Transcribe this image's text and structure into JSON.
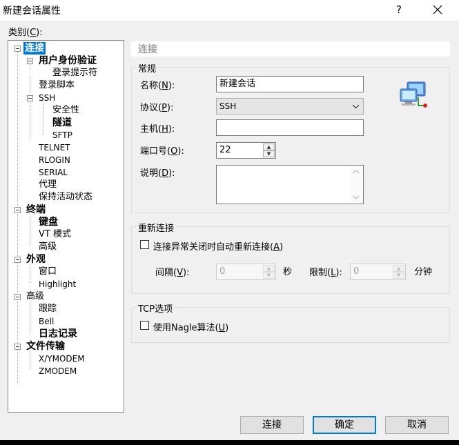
{
  "window": {
    "title": "新建会话属性",
    "help": "?",
    "close": "✕"
  },
  "category": {
    "label": "类别(",
    "label_key": "C",
    "label_end": "):"
  },
  "tree": {
    "n_connect": "连接",
    "n_user_auth": "用户身份验证",
    "n_login_prompt": "登录提示符",
    "n_login_script": "登录脚本",
    "n_ssh": "SSH",
    "n_security": "安全性",
    "n_tunnel": "隧道",
    "n_sftp": "SFTP",
    "n_telnet": "TELNET",
    "n_rlogin": "RLOGIN",
    "n_serial": "SERIAL",
    "n_proxy": "代理",
    "n_keepalive": "保持活动状态",
    "n_terminal": "终端",
    "n_keyboard": "键盘",
    "n_vtmode": "VT 模式",
    "n_term_adv": "高级",
    "n_appearance": "外观",
    "n_window": "窗口",
    "n_highlight": "Highlight",
    "n_advanced": "高级",
    "n_trace": "跟踪",
    "n_bell": "Bell",
    "n_log": "日志记录",
    "n_transfer": "文件传输",
    "n_xymodem": "X/YMODEM",
    "n_zmodem": "ZMODEM"
  },
  "panel": {
    "section_title": "连接",
    "general": {
      "title": "常规",
      "name_label": "名称(",
      "name_key": "N",
      "name_end": "):",
      "name_value": "新建会话",
      "protocol_label": "协议(",
      "protocol_key": "P",
      "protocol_end": "):",
      "protocol_value": "SSH",
      "host_label": "主机(",
      "host_key": "H",
      "host_end": "):",
      "host_value": "",
      "port_label": "端口号(",
      "port_key": "O",
      "port_end": "):",
      "port_value": "22",
      "desc_label": "说明(",
      "desc_key": "D",
      "desc_end": "):",
      "desc_value": ""
    },
    "reconnect": {
      "title": "重新连接",
      "auto_label": "连接异常关闭时自动重新连接(",
      "auto_key": "A",
      "auto_end": ")",
      "interval_label": "间隔(",
      "interval_key": "V",
      "interval_end": "):",
      "interval_value": "0",
      "interval_unit": "秒",
      "limit_label": "限制(",
      "limit_key": "L",
      "limit_end": "):",
      "limit_value": "0",
      "limit_unit": "分钟"
    },
    "tcp": {
      "title": "TCP选项",
      "nagle_label": "使用Nagle算法(",
      "nagle_key": "U",
      "nagle_end": ")"
    }
  },
  "buttons": {
    "connect": "连接",
    "ok": "确定",
    "cancel": "取消"
  },
  "icons": {
    "up": "▲",
    "down": "▼",
    "chev": "⌵"
  }
}
